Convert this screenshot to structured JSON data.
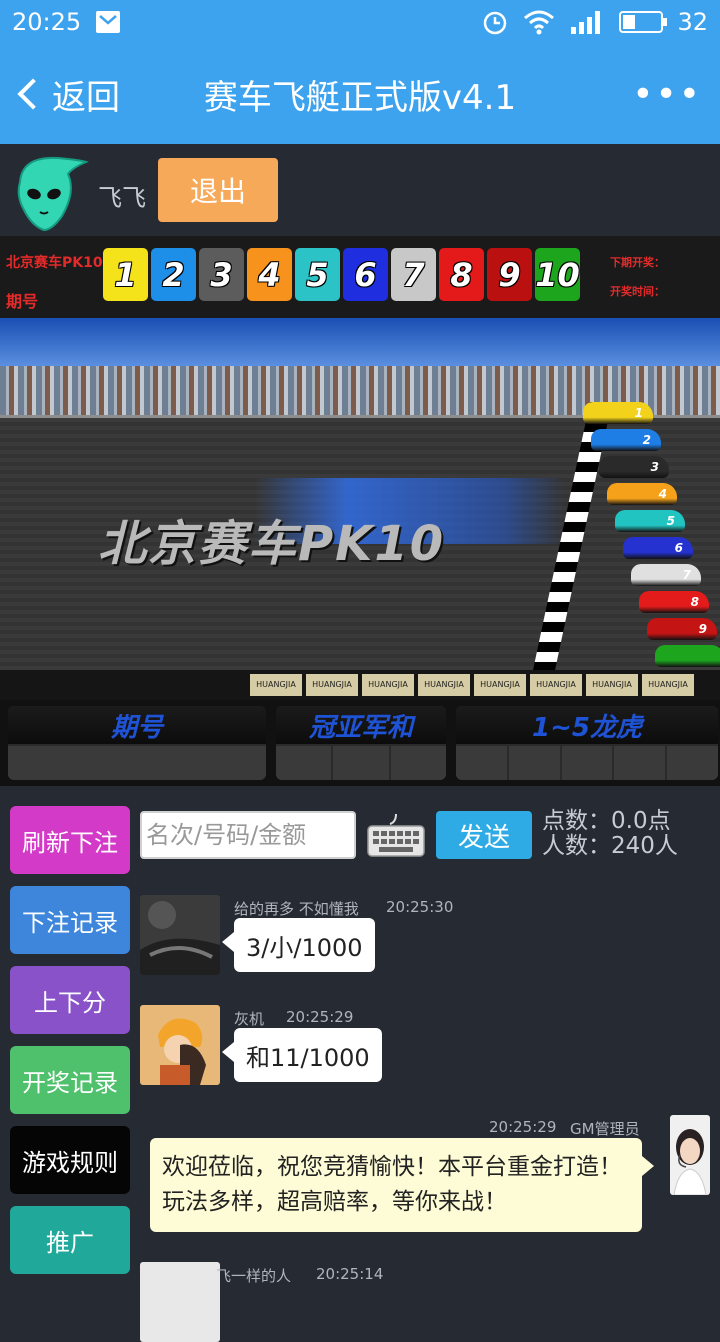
{
  "status_bar": {
    "time": "20:25",
    "battery": "32",
    "battery_fraction": 0.32
  },
  "header": {
    "back_label": "返回",
    "title": "赛车飞艇正式版v4.1",
    "more_label": "•••"
  },
  "user": {
    "name": "飞飞",
    "logout_label": "退出"
  },
  "pk10": {
    "game_label": "北京赛车PK10",
    "period_label": "期号",
    "next_draw_label": "下期开奖：",
    "draw_time_label": "开奖时间：",
    "balls": [
      {
        "num": "1",
        "color": "#f4e21b"
      },
      {
        "num": "2",
        "color": "#1e8fe8"
      },
      {
        "num": "3",
        "color": "#5c5c5c"
      },
      {
        "num": "4",
        "color": "#f7931d"
      },
      {
        "num": "5",
        "color": "#2bc3c6"
      },
      {
        "num": "6",
        "color": "#1f2fe0"
      },
      {
        "num": "7",
        "color": "#c8c8c8"
      },
      {
        "num": "8",
        "color": "#e41a1a"
      },
      {
        "num": "9",
        "color": "#bb1010"
      },
      {
        "num": "10",
        "color": "#1ea51e"
      }
    ]
  },
  "track": {
    "title": "北京赛车PK10",
    "sponsor": "HUANGJIA",
    "cars": [
      {
        "num": "1",
        "color": "#f2d21b"
      },
      {
        "num": "2",
        "color": "#1f7ee6"
      },
      {
        "num": "3",
        "color": "#2a2a2a"
      },
      {
        "num": "4",
        "color": "#f5a21a"
      },
      {
        "num": "5",
        "color": "#22c4c2"
      },
      {
        "num": "6",
        "color": "#2532d0"
      },
      {
        "num": "7",
        "color": "#e0e0e0"
      },
      {
        "num": "8",
        "color": "#e31b1b"
      },
      {
        "num": "9",
        "color": "#c41414"
      },
      {
        "num": "",
        "color": "#1ea51e"
      }
    ]
  },
  "info_panel": {
    "period": "期号",
    "champion_sum": "冠亚军和",
    "dragon_tiger": "1~5龙虎"
  },
  "menu": {
    "refresh_bet": "刷新下注",
    "bet_record": "下注记录",
    "points": "上下分",
    "draw_record": "开奖记录",
    "game_rules": "游戏规则",
    "promote": "推广"
  },
  "input": {
    "placeholder": "名次/号码/金额",
    "send_label": "发送",
    "points_stat": "点数：0.0点",
    "people_stat": "人数：240人"
  },
  "chat": {
    "messages": [
      {
        "name": "给的再多 不如懂我",
        "time": "20:25:30",
        "text": "3/小/1000"
      },
      {
        "name": "灰机",
        "time": "20:25:29",
        "text": "和11/1000"
      },
      {
        "name": "GM管理员",
        "time": "20:25:29",
        "text": "欢迎莅临，祝您竞猜愉快！本平台重金打造！玩法多样，超高赔率，等你来战！"
      },
      {
        "name": "飞一样的人",
        "time": "20:25:14"
      }
    ]
  }
}
